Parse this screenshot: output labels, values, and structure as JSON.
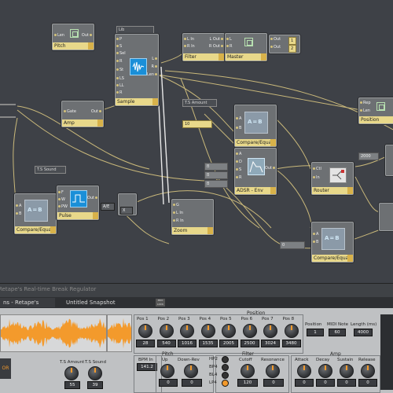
{
  "canvas": {
    "modules": {
      "pitch": {
        "title": "Pitch",
        "in": "Len",
        "out": "Out"
      },
      "amp": {
        "title": "Amp",
        "in": "Gate",
        "out": "Out"
      },
      "sample": {
        "title": "Sample",
        "top_label": "Lib",
        "inputs": [
          "P",
          "S",
          "Sel",
          "R",
          "St",
          "LS",
          "LL",
          "R"
        ],
        "outputs": [
          "L",
          "R",
          "Len"
        ]
      },
      "filter": {
        "title": "Filter",
        "inputs": [
          "L In",
          "R In"
        ],
        "outputs": [
          "L Out",
          "R Out"
        ]
      },
      "master": {
        "title": "Master",
        "inputs": [
          "L",
          "R"
        ],
        "outputs": [
          "Out"
        ]
      },
      "out_values": [
        "1",
        "2"
      ],
      "ts_amount": {
        "label": "T.S Amount"
      },
      "value_10": {
        "label": "10"
      },
      "compare_equal_top": {
        "title": "Compare/Equal",
        "inputs": [
          "A",
          "B"
        ],
        "display": "A=B"
      },
      "adsr": {
        "title": "ADSR - Env",
        "inputs": [
          "A",
          "D",
          "S",
          "R"
        ],
        "outputs": [
          "Out"
        ]
      },
      "router": {
        "title": "Router",
        "inputs": [
          "Ctl",
          "In"
        ]
      },
      "position": {
        "title": "Position",
        "inputs": [
          "Rep",
          "Len"
        ]
      },
      "value_2000": {
        "label": "2000"
      },
      "ts_sound": {
        "label": "T.S Sound"
      },
      "compare_equal_left": {
        "title": "Compare/Equal",
        "inputs": [
          "A",
          "B"
        ],
        "display": "A=B"
      },
      "pulse": {
        "title": "Pulse",
        "inputs": [
          "F",
          "W",
          "PW"
        ],
        "outputs": [
          "Out"
        ]
      },
      "ae_box": {
        "label": "A/E"
      },
      "x_box": {
        "label": "X"
      },
      "zoom": {
        "title": "Zoom",
        "inputs": [
          "G",
          "L In",
          "R In"
        ]
      },
      "compare_equal_bottom": {
        "title": "Compare/Equal",
        "display": "A=B"
      },
      "value_0": {
        "label": "0"
      }
    }
  },
  "statusbar": {
    "text": "Retape's Real-time Break Regulator"
  },
  "tabs": [
    {
      "label": "ns - Retape's Real-ti"
    },
    {
      "label": "Untitled Snapshot"
    }
  ],
  "tab_icon": "MIDI LOCK",
  "panel": {
    "position_title": "Position",
    "pos_knobs": [
      {
        "label": "Pos 1",
        "value": "28"
      },
      {
        "label": "Pos 2",
        "value": "540"
      },
      {
        "label": "Pos 3",
        "value": "1016"
      },
      {
        "label": "Pos 4",
        "value": "1535"
      },
      {
        "label": "Pos 5",
        "value": "2005"
      },
      {
        "label": "Pos 6",
        "value": "2500"
      },
      {
        "label": "Pos 7",
        "value": "3024"
      },
      {
        "label": "Pos 8",
        "value": "3480"
      }
    ],
    "position_val": {
      "label": "Position",
      "value": "1"
    },
    "midi_note": {
      "label": "MIDI Note",
      "value": "60"
    },
    "length": {
      "label": "Length (ms)",
      "value": "4000"
    },
    "ts_amount": {
      "label": "T.S Amount",
      "value": "55"
    },
    "ts_sound": {
      "label": "T.S Sound",
      "value": "39"
    },
    "bpm": {
      "label": "BPM In",
      "value": "141.2"
    },
    "pitch_title": "Pitch",
    "pitch_knobs": [
      {
        "label": "Up",
        "value": "0"
      },
      {
        "label": "Down-Rev",
        "value": "0"
      }
    ],
    "filter_title": "Filter",
    "filter_types": [
      "HP2",
      "BP4",
      "BL4",
      "LP4"
    ],
    "filter_knobs": [
      {
        "label": "Cutoff",
        "value": "120"
      },
      {
        "label": "Resonance",
        "value": "0"
      }
    ],
    "amp_title": "Amp",
    "amp_knobs": [
      {
        "label": "Attack",
        "value": "0"
      },
      {
        "label": "Decay",
        "value": "0"
      },
      {
        "label": "Sustain",
        "value": "0"
      },
      {
        "label": "Release",
        "value": "0"
      }
    ],
    "or_button": "OR",
    "accent_color": "#f39a2c"
  }
}
